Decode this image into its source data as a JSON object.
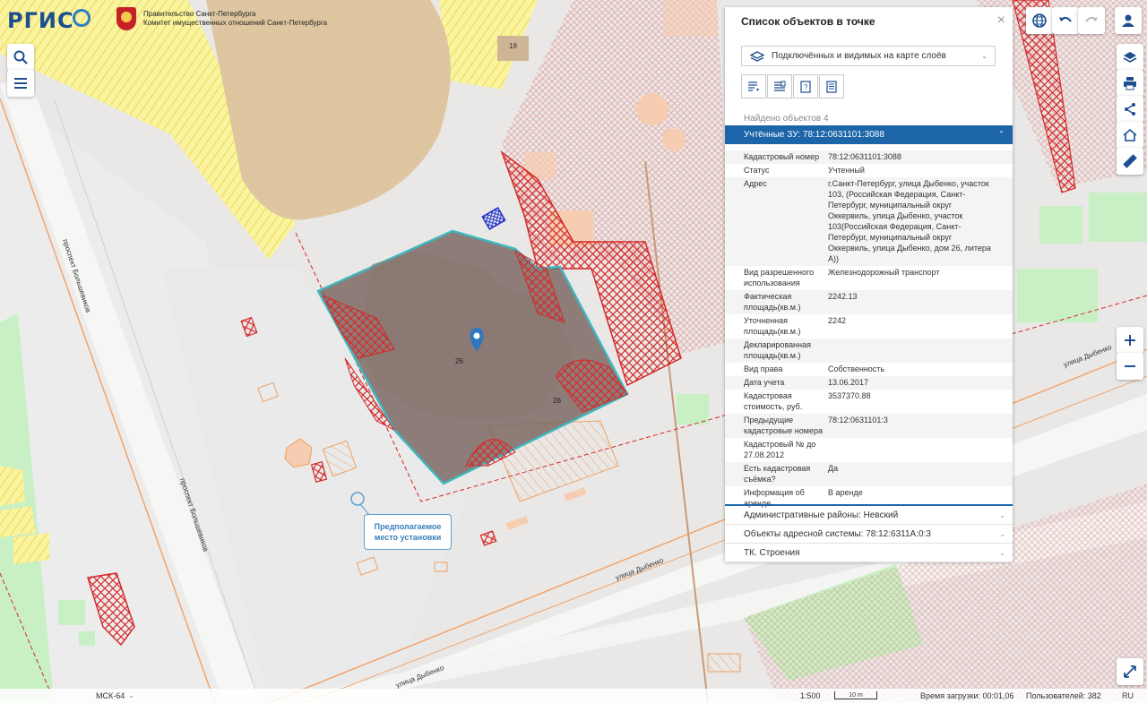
{
  "header": {
    "logo_text": "РГИС",
    "gov_line1": "Правительство Санкт-Петербурга",
    "gov_line2": "Комитет имущественных отношений Санкт-Петербурга"
  },
  "map": {
    "street_bolshevikov_1": "проспект Большевиков",
    "street_bolshevikov_2": "проспект Большевиков",
    "street_dybenko_1": "улица Дыбенко",
    "street_dybenko_2": "улица Дыбенко",
    "street_dybenko_3": "улица Дыбенко",
    "label_18": "18",
    "label_26a": "26",
    "label_26b": "26",
    "callout_line1": "Предполагаемое",
    "callout_line2": "место установки"
  },
  "panel": {
    "title": "Список объектов в точке",
    "close": "×",
    "layer_select": "Подключённых и видимых на карте слоёв",
    "found": "Найдено объектов 4",
    "active_section": "Учтённые ЗУ: 78:12:0631101:3088",
    "rows": [
      {
        "k": "Кадастровый номер",
        "v": "78:12:0631101:3088"
      },
      {
        "k": "Статус",
        "v": "Учтенный"
      },
      {
        "k": "Адрес",
        "v": "г.Санкт-Петербург, улица Дыбенко, участок 103, (Российская Федерация, Санкт-Петербург, муниципальный округ Оккервиль, улица Дыбенко, участок 103(Российская Федерация, Санкт-Петербург, муниципальный округ Оккервиль, улица Дыбенко, дом 26, литера А))"
      },
      {
        "k": "Вид разрешенного использования",
        "v": "Железнодорожный транспорт"
      },
      {
        "k": "Фактическая площадь(кв.м.)",
        "v": "2242.13"
      },
      {
        "k": "Уточненная площадь(кв.м.)",
        "v": "2242"
      },
      {
        "k": "Декларированная площадь(кв.м.)",
        "v": ""
      },
      {
        "k": "Вид права",
        "v": "Собственность"
      },
      {
        "k": "Дата учета",
        "v": "13.06.2017"
      },
      {
        "k": "Кадастровая стоимость, руб.",
        "v": "3537370.88"
      },
      {
        "k": "Предыдущие кадастровые номера",
        "v": "78:12:0631101:3"
      },
      {
        "k": "Кадастровый № до 27.08.2012",
        "v": ""
      },
      {
        "k": "Есть кадастровая съёмка?",
        "v": "Да"
      },
      {
        "k": "Информация об аренде",
        "v": "В аренде"
      }
    ],
    "sections": [
      "Административные районы: Невский",
      "Объекты адресной системы: 78:12:6311А:0:3",
      "ТК. Строения"
    ]
  },
  "statusbar": {
    "crs": "МСК-64",
    "scale": "1:500",
    "scale_bar": "10 m",
    "load_time": "Время загрузки: 00:01,06",
    "users": "Пользователей: 382",
    "lang": "RU"
  },
  "icons": {
    "search": "search-icon",
    "menu": "menu-icon",
    "globe": "globe-icon",
    "undo": "undo-icon",
    "redo": "redo-icon",
    "user": "user-icon",
    "layers": "layers-icon",
    "print": "print-icon",
    "share": "share-icon",
    "house": "house-icon",
    "ruler": "ruler-icon",
    "zoom_in": "plus-icon",
    "zoom_out": "minus-icon",
    "fullscreen": "fullscreen-icon",
    "marker": "map-pin-icon"
  },
  "colors": {
    "accent": "#1b65a8",
    "parcel_fill": "#7d6963",
    "parcel_border": "#3fb6bf",
    "hatch_red": "#d62828",
    "hatch_yellow": "#f3e04a",
    "green_area": "#c9f0c4",
    "street_orange": "#f2a46b"
  }
}
